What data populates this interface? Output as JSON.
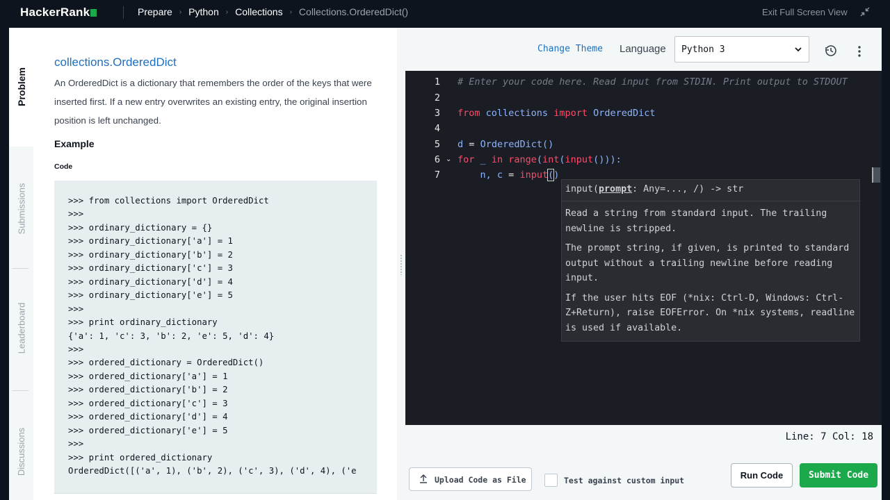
{
  "topbar": {
    "logo": "HackerRank",
    "breadcrumbs": [
      "Prepare",
      "Python",
      "Collections"
    ],
    "current": "Collections.OrderedDict()",
    "exit_fullscreen": "Exit Full Screen View"
  },
  "sidebar": {
    "tabs": [
      "Problem",
      "Submissions",
      "Leaderboard",
      "Discussions"
    ]
  },
  "problem": {
    "title": "collections.OrderedDict",
    "description": "An OrderedDict is a dictionary that remembers the order of the keys that were inserted first. If a new entry overwrites an existing entry, the original insertion position is left unchanged.",
    "example_heading": "Example",
    "code_label": "Code",
    "code_lines": [
      ">>> from collections import OrderedDict",
      ">>>",
      ">>> ordinary_dictionary = {}",
      ">>> ordinary_dictionary['a'] = 1",
      ">>> ordinary_dictionary['b'] = 2",
      ">>> ordinary_dictionary['c'] = 3",
      ">>> ordinary_dictionary['d'] = 4",
      ">>> ordinary_dictionary['e'] = 5",
      ">>>",
      ">>> print ordinary_dictionary",
      "{'a': 1, 'c': 3, 'b': 2, 'e': 5, 'd': 4}",
      ">>>",
      ">>> ordered_dictionary = OrderedDict()",
      ">>> ordered_dictionary['a'] = 1",
      ">>> ordered_dictionary['b'] = 2",
      ">>> ordered_dictionary['c'] = 3",
      ">>> ordered_dictionary['d'] = 4",
      ">>> ordered_dictionary['e'] = 5",
      ">>>",
      ">>> print ordered_dictionary",
      "OrderedDict([('a', 1), ('b', 2), ('c', 3), ('d', 4), ('e"
    ]
  },
  "editor_toolbar": {
    "change_theme": "Change Theme",
    "language_label": "Language",
    "language_value": "Python 3"
  },
  "editor": {
    "line_numbers": [
      "1",
      "2",
      "3",
      "4",
      "5",
      "6",
      "7"
    ],
    "lines": {
      "l1": "# Enter your code here. Read input from STDIN. Print output to STDOUT",
      "l3_kw1": "from",
      "l3_mod": "collections",
      "l3_kw2": "import",
      "l3_cls": "OrderedDict",
      "l5_var": "d",
      "l5_op": "=",
      "l5_call": "OrderedDict()",
      "l6_for": "for",
      "l6_var": "_",
      "l6_in": "in",
      "l6_range": "range",
      "l6_int": "int",
      "l6_input": "input",
      "l6_rest": "())):",
      "l7_vars": "n, c",
      "l7_op": "=",
      "l7_fn": "input",
      "l7_open": "(",
      "l7_close": ")"
    },
    "tooltip": {
      "sig_name": "input(",
      "sig_param": "prompt",
      "sig_rest": ": Any=..., /) -> str",
      "p1": "Read a string from standard input.  The trailing newline is stripped.",
      "p2": "The prompt string, if given, is printed to standard output without a trailing newline before reading input.",
      "p3": "If the user hits EOF (*nix: Ctrl-D, Windows: Ctrl-Z+Return), raise EOFError. On *nix systems, readline is used if available."
    },
    "status": "Line: 7 Col: 18"
  },
  "actions": {
    "upload": "Upload Code as File",
    "custom_input": "Test against custom input",
    "run": "Run Code",
    "submit": "Submit Code"
  },
  "colors": {
    "brand_green": "#1ba94c",
    "link_blue": "#1e6fbf",
    "editor_bg": "#1b1d24",
    "keyword": "#ff4a6b",
    "identifier": "#8db4ff"
  }
}
